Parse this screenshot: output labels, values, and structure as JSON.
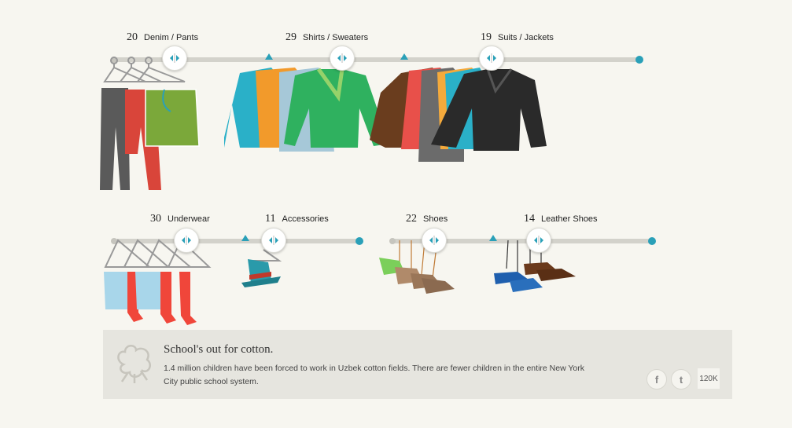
{
  "categories": [
    {
      "count": "20",
      "label": "Denim / Pants"
    },
    {
      "count": "29",
      "label": "Shirts / Sweaters"
    },
    {
      "count": "19",
      "label": "Suits / Jackets"
    },
    {
      "count": "30",
      "label": "Underwear"
    },
    {
      "count": "11",
      "label": "Accessories"
    },
    {
      "count": "22",
      "label": "Shoes"
    },
    {
      "count": "14",
      "label": "Leather Shoes"
    }
  ],
  "panel": {
    "title": "School's out for cotton.",
    "body": "1.4 million children have been forced to work in Uzbek cotton fields. There are fewer children in the entire New York City public school system.",
    "share_count": "120K"
  },
  "icons": {
    "slider_handle": "slider-arrows-icon",
    "facebook": "facebook-icon",
    "twitter": "twitter-icon",
    "cotton": "cotton-icon"
  },
  "colors": {
    "accent": "#2aa0b8",
    "rail": "#d3d2cb",
    "background": "#f7f6f0",
    "panel": "#e6e5df"
  }
}
